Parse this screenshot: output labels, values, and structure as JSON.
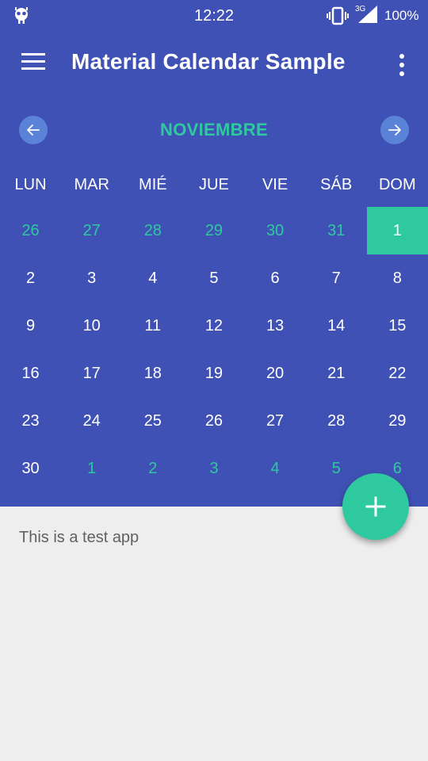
{
  "status_bar": {
    "time": "12:22",
    "network": "3G",
    "battery": "100%",
    "icons": [
      "bot-icon",
      "vibrate-icon",
      "signal-icon"
    ]
  },
  "toolbar": {
    "title": "Material Calendar Sample",
    "menu_icon": "hamburger-menu-icon",
    "overflow_icon": "more-vert-icon"
  },
  "calendar": {
    "month": "NOVIEMBRE",
    "prev_icon": "arrow-left-icon",
    "next_icon": "arrow-right-icon",
    "weekdays": [
      "LUN",
      "MAR",
      "MIÉ",
      "JUE",
      "VIE",
      "SÁB",
      "DOM"
    ],
    "weeks": [
      [
        "26",
        "27",
        "28",
        "29",
        "30",
        "31",
        "1"
      ],
      [
        "2",
        "3",
        "4",
        "5",
        "6",
        "7",
        "8"
      ],
      [
        "9",
        "10",
        "11",
        "12",
        "13",
        "14",
        "15"
      ],
      [
        "16",
        "17",
        "18",
        "19",
        "20",
        "21",
        "22"
      ],
      [
        "23",
        "24",
        "25",
        "26",
        "27",
        "28",
        "29"
      ],
      [
        "30",
        "1",
        "2",
        "3",
        "4",
        "5",
        "6"
      ]
    ],
    "other_month": [
      [
        true,
        true,
        true,
        true,
        true,
        true,
        false
      ],
      [
        false,
        false,
        false,
        false,
        false,
        false,
        false
      ],
      [
        false,
        false,
        false,
        false,
        false,
        false,
        false
      ],
      [
        false,
        false,
        false,
        false,
        false,
        false,
        false
      ],
      [
        false,
        false,
        false,
        false,
        false,
        false,
        false
      ],
      [
        false,
        true,
        true,
        true,
        true,
        true,
        true
      ]
    ],
    "selected": {
      "week": 0,
      "day": 6
    },
    "colors": {
      "primary": "#3f51b5",
      "accent": "#2ec99e",
      "nav_button": "#5a83d8"
    }
  },
  "content": {
    "text": "This is a test app"
  },
  "fab": {
    "icon": "plus-icon"
  }
}
